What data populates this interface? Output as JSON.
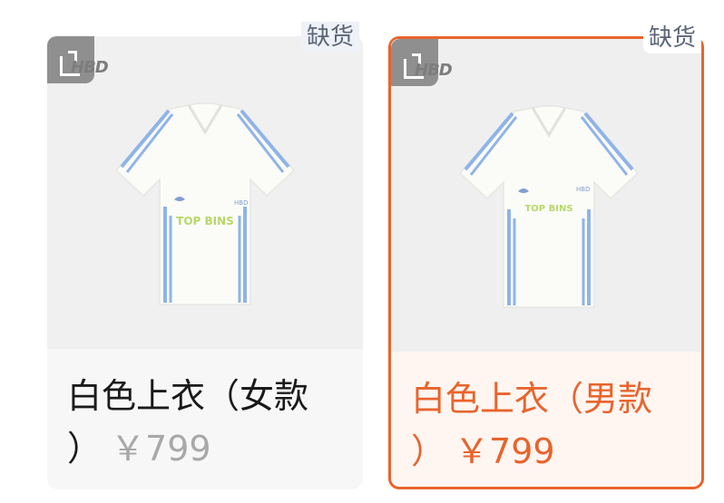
{
  "products": [
    {
      "stock_badge": "缺货",
      "brand": "HBD",
      "shirt_print": "TOP BINS",
      "name_line1": "白色上衣（女款",
      "name_line2": "）",
      "price": "￥799",
      "selected": false
    },
    {
      "stock_badge": "缺货",
      "brand": "HBD",
      "shirt_print": "TOP BINS",
      "name_line1": "白色上衣（男款",
      "name_line2": "）",
      "price": "￥799",
      "selected": true
    }
  ],
  "colors": {
    "accent": "#e8642c",
    "stripe": "#8fb4e8",
    "print_green": "#b7d86a"
  }
}
